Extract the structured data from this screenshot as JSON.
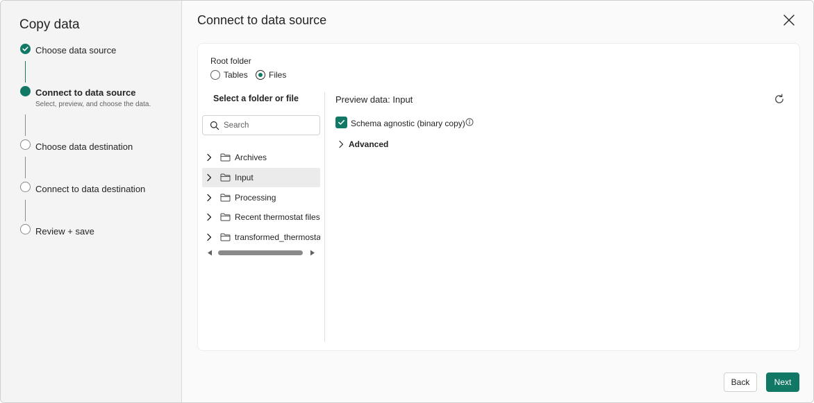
{
  "colors": {
    "accent": "#117865",
    "sidebar_bg": "#f4f4f4",
    "selected_row": "#ebebeb"
  },
  "wizard": {
    "title": "Copy data",
    "steps": [
      {
        "label": "Choose data source",
        "state": "done",
        "sub": ""
      },
      {
        "label": "Connect to data source",
        "state": "current",
        "sub": "Select, preview, and choose the data."
      },
      {
        "label": "Choose data destination",
        "state": "todo",
        "sub": ""
      },
      {
        "label": "Connect to data destination",
        "state": "todo",
        "sub": ""
      },
      {
        "label": "Review + save",
        "state": "todo",
        "sub": ""
      }
    ]
  },
  "main": {
    "title": "Connect to data source",
    "close_icon": "close-icon"
  },
  "root_folder": {
    "label": "Root folder",
    "options": [
      {
        "label": "Tables",
        "checked": false
      },
      {
        "label": "Files",
        "checked": true
      }
    ]
  },
  "tree": {
    "heading": "Select a folder or file",
    "search_placeholder": "Search",
    "search_value": "",
    "items": [
      {
        "label": "Archives",
        "selected": false
      },
      {
        "label": "Input",
        "selected": true
      },
      {
        "label": "Processing",
        "selected": false
      },
      {
        "label": "Recent thermostat files",
        "selected": false
      },
      {
        "label": "transformed_thermostat",
        "selected": false
      }
    ]
  },
  "preview": {
    "title": "Preview data: Input",
    "schema_agnostic_label": "Schema agnostic (binary copy)",
    "schema_agnostic_checked": true,
    "advanced_label": "Advanced"
  },
  "footer": {
    "back_label": "Back",
    "next_label": "Next"
  }
}
